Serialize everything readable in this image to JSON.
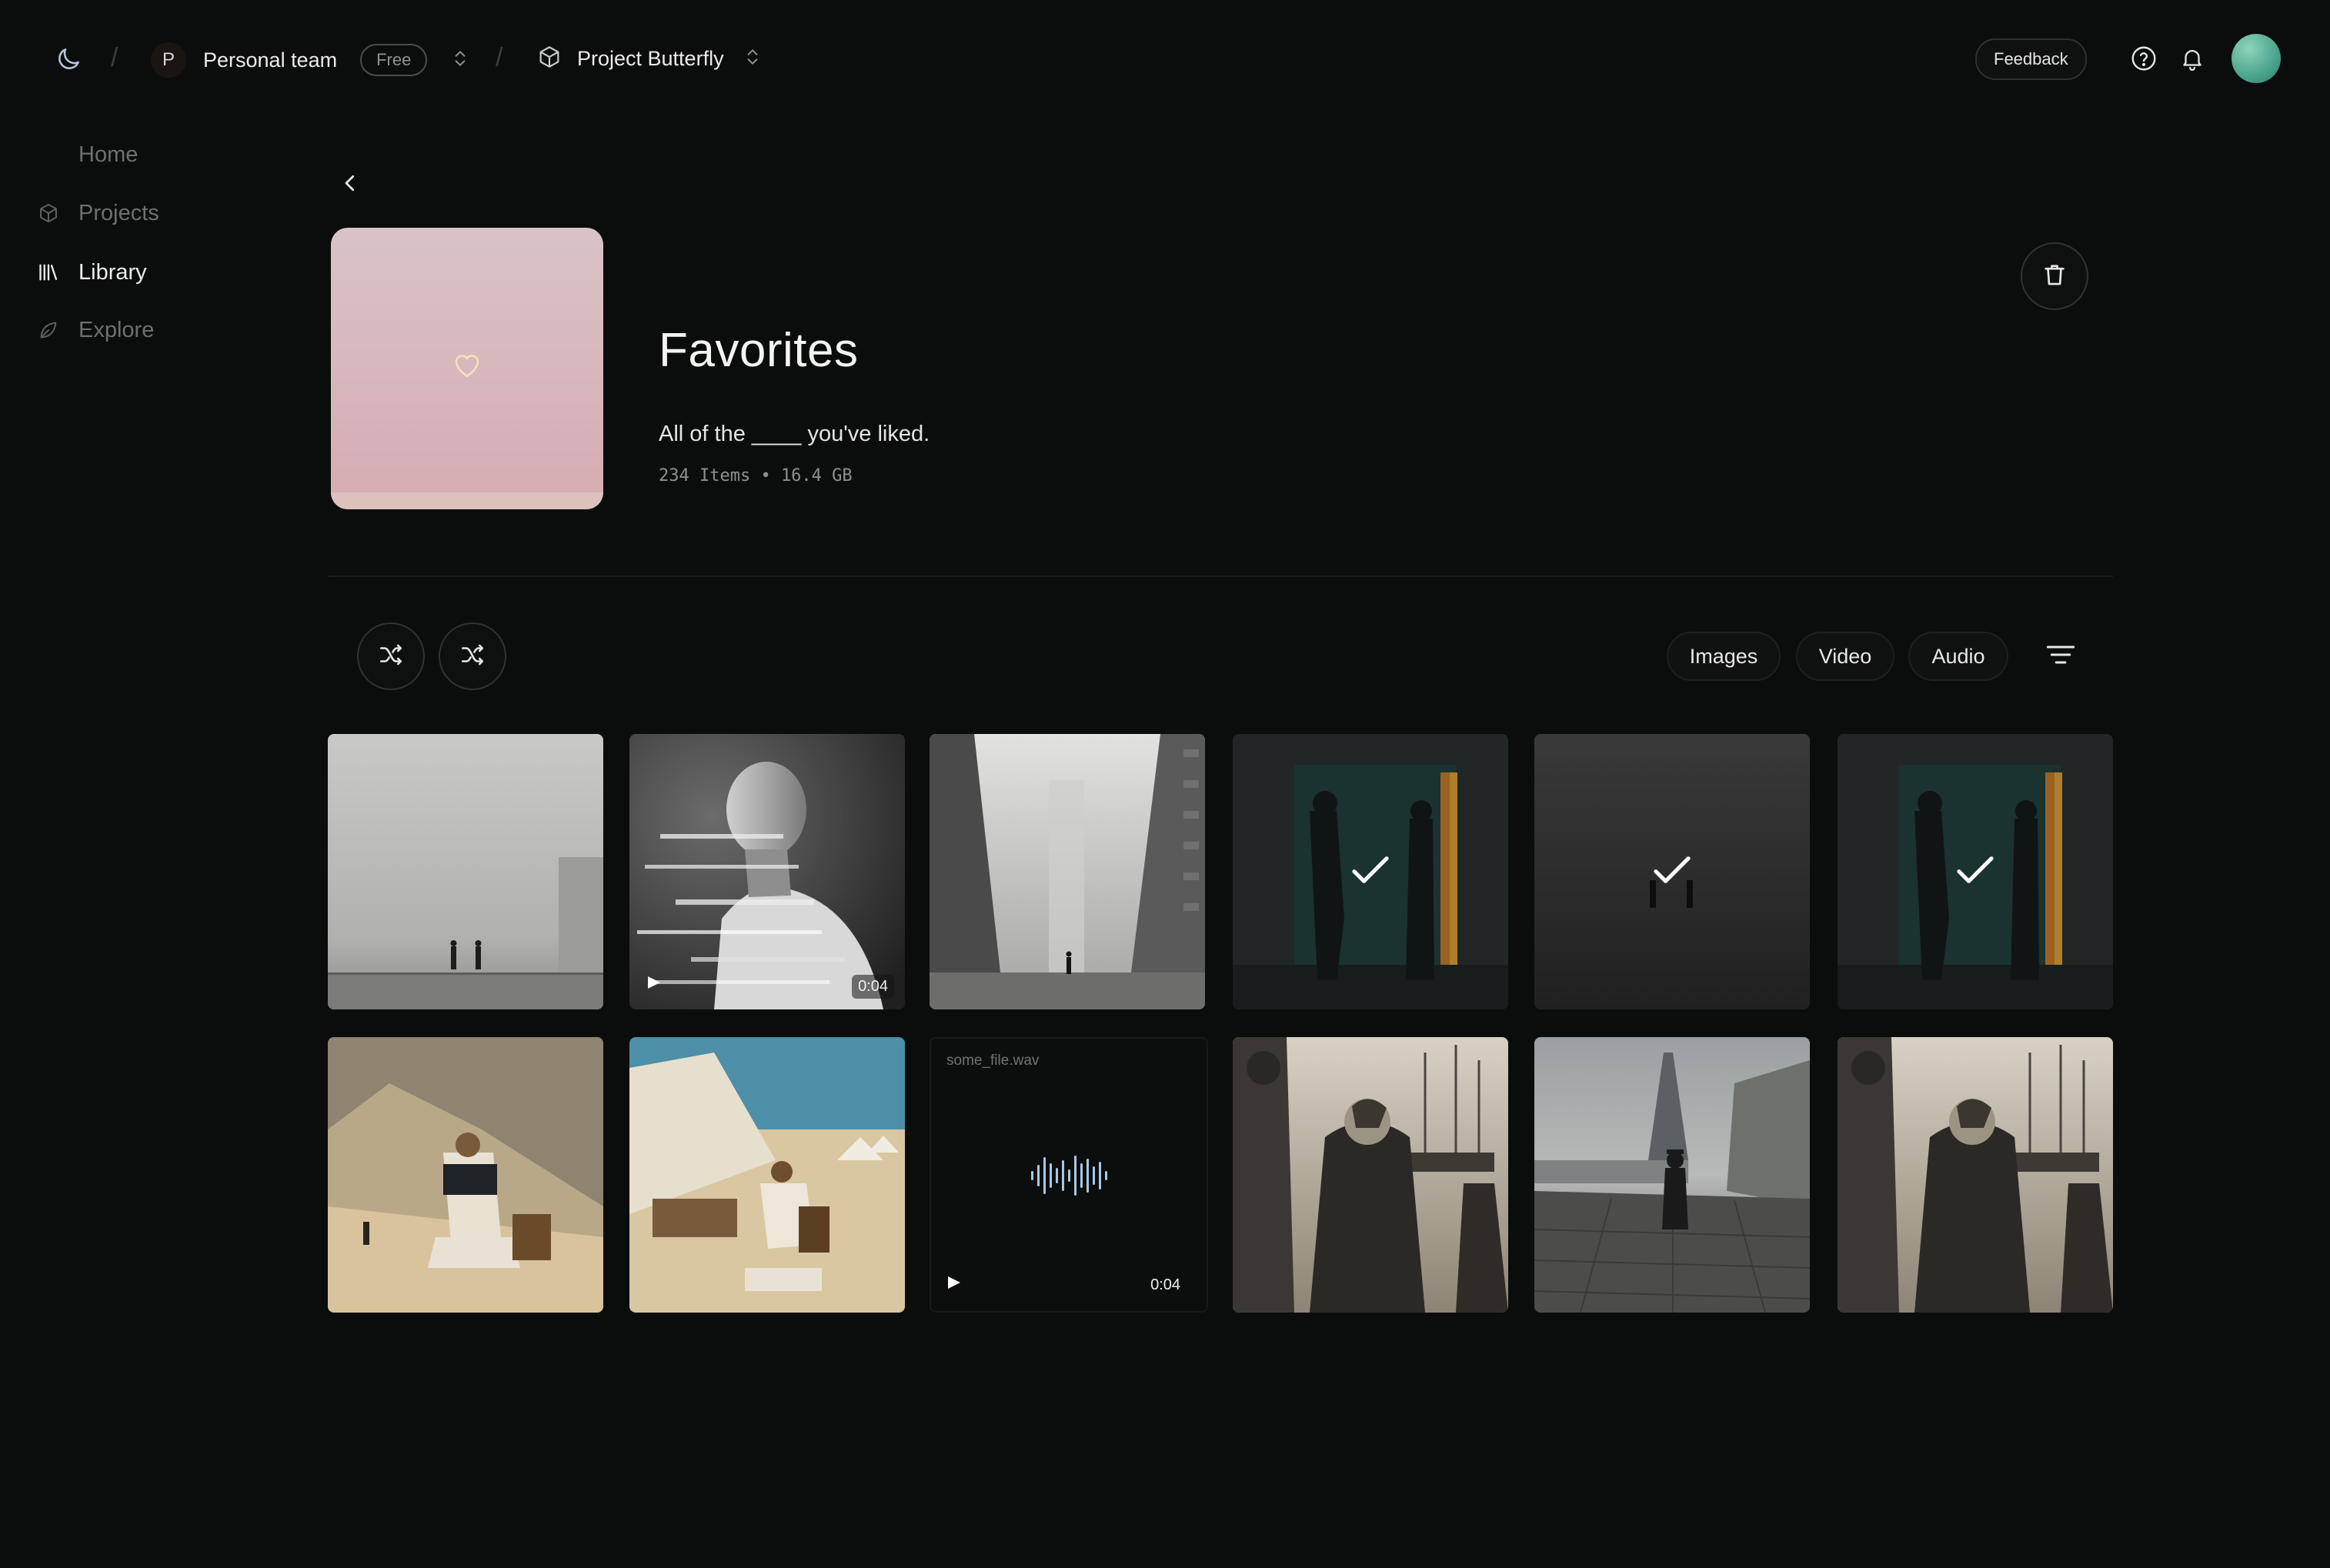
{
  "topbar": {
    "team_initial": "P",
    "team_name": "Personal team",
    "plan_badge": "Free",
    "project_name": "Project Butterfly",
    "feedback_label": "Feedback",
    "icons": [
      "moon-icon",
      "chevron-updown-icon",
      "cube-icon",
      "help-icon",
      "bell-icon"
    ]
  },
  "sidebar": {
    "items": [
      {
        "label": "Home",
        "icon": "",
        "active": false
      },
      {
        "label": "Projects",
        "icon": "cube-icon",
        "active": false
      },
      {
        "label": "Library",
        "icon": "library-icon",
        "active": true
      },
      {
        "label": "Explore",
        "icon": "leaf-icon",
        "active": false
      }
    ]
  },
  "collection": {
    "title": "Favorites",
    "description": "All of the ____ you've liked.",
    "meta": "234 Items • 16.4 GB",
    "cover_icon": "heart-icon"
  },
  "toolbar": {
    "filters": [
      "Images",
      "Video",
      "Audio"
    ],
    "actions": [
      "shuffle-icon",
      "shuffle-icon",
      "sort-lines-icon",
      "trash-icon"
    ]
  },
  "grid": {
    "items": [
      {
        "type": "image",
        "scene": "fog-handshake",
        "selected": false
      },
      {
        "type": "video",
        "scene": "glitch-portrait",
        "selected": false,
        "duration": "0:04"
      },
      {
        "type": "image",
        "scene": "fog-corridor",
        "selected": false
      },
      {
        "type": "image",
        "scene": "doorway-handshake",
        "selected": true
      },
      {
        "type": "image",
        "scene": "dark-fog",
        "selected": true
      },
      {
        "type": "image",
        "scene": "doorway-handshake",
        "selected": true
      },
      {
        "type": "image",
        "scene": "tent-painting",
        "selected": false
      },
      {
        "type": "image",
        "scene": "desert-painting",
        "selected": false
      },
      {
        "type": "audio",
        "file_name": "some_file.wav",
        "selected": false,
        "duration": "0:04"
      },
      {
        "type": "image",
        "scene": "harbor-officer",
        "selected": false
      },
      {
        "type": "image",
        "scene": "paris-rain",
        "selected": false
      },
      {
        "type": "image",
        "scene": "harbor-officer",
        "selected": false
      }
    ]
  },
  "colors": {
    "background": "#0b0d0d",
    "text_primary": "#eeeeeb",
    "text_muted": "#6c706e",
    "cover_pink": "#d6acb2",
    "avatar_teal": "#4aa48d",
    "audio_wave": "#a9c7e3"
  }
}
